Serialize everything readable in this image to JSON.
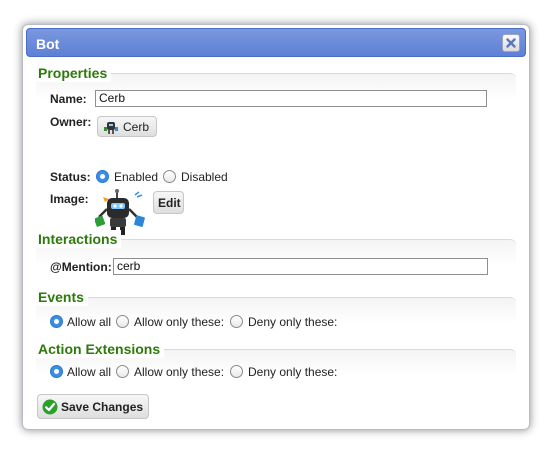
{
  "dialog": {
    "title": "Bot"
  },
  "properties": {
    "legend": "Properties",
    "name_label": "Name:",
    "name_value": "Cerb",
    "owner_label": "Owner:",
    "owner_button": "Cerb",
    "status_label": "Status:",
    "status_options": [
      "Enabled",
      "Disabled"
    ],
    "status_selected": "Enabled",
    "image_label": "Image:",
    "edit_button": "Edit"
  },
  "interactions": {
    "legend": "Interactions",
    "mention_label": "@Mention:",
    "mention_value": "cerb"
  },
  "events": {
    "legend": "Events",
    "options": [
      "Allow all",
      "Allow only these:",
      "Deny only these:"
    ],
    "selected": "Allow all"
  },
  "action_extensions": {
    "legend": "Action Extensions",
    "options": [
      "Allow all",
      "Allow only these:",
      "Deny only these:"
    ],
    "selected": "Allow all"
  },
  "footer": {
    "save_button": "Save Changes"
  },
  "colors": {
    "titlebar": "#6686d9",
    "legend": "#2c7a0a",
    "radio_selected": "#3a8ee6",
    "save_icon": "#2aa02a"
  },
  "icons": [
    "close-icon",
    "bot-icon",
    "check-circle-icon"
  ]
}
